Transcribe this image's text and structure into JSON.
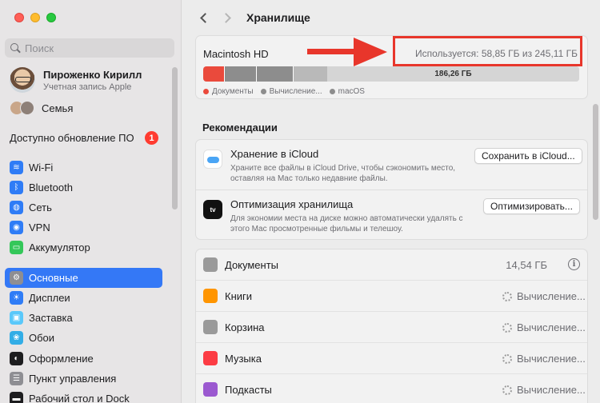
{
  "window": {
    "title": "Хранилище"
  },
  "search": {
    "placeholder": "Поиск"
  },
  "account": {
    "name": "Пироженко Кирилл",
    "subtitle": "Учетная запись Apple"
  },
  "family": {
    "label": "Семья"
  },
  "update": {
    "label": "Доступно обновление ПО",
    "badge": "1"
  },
  "sidebar": {
    "items": [
      {
        "label": "Wi‑Fi",
        "icon": "wifi-icon",
        "color": "#2f7cf6"
      },
      {
        "label": "Bluetooth",
        "icon": "bluetooth-icon",
        "color": "#2f7cf6"
      },
      {
        "label": "Сеть",
        "icon": "network-icon",
        "color": "#2f7cf6"
      },
      {
        "label": "VPN",
        "icon": "vpn-icon",
        "color": "#2f7cf6"
      },
      {
        "label": "Аккумулятор",
        "icon": "battery-icon",
        "color": "#34c759"
      },
      {
        "label": "Основные",
        "icon": "gear-icon",
        "color": "#8e8e93",
        "active": true
      },
      {
        "label": "Дисплеи",
        "icon": "display-icon",
        "color": "#2f7cf6"
      },
      {
        "label": "Заставка",
        "icon": "screensaver-icon",
        "color": "#5ac8fa"
      },
      {
        "label": "Обои",
        "icon": "wallpaper-icon",
        "color": "#32ade6"
      },
      {
        "label": "Оформление",
        "icon": "appearance-icon",
        "color": "#1d1d1f"
      },
      {
        "label": "Пункт управления",
        "icon": "control-center-icon",
        "color": "#8e8e93"
      },
      {
        "label": "Рабочий стол и Dock",
        "icon": "dock-icon",
        "color": "#1d1d1f"
      }
    ]
  },
  "storage": {
    "disk_name": "Macintosh HD",
    "usage_text": "Используется: 58,85 ГБ из 245,11 ГБ",
    "free_label": "186,26 ГБ",
    "legend": [
      {
        "label": "Документы",
        "color": "#ea4a3c"
      },
      {
        "label": "Вычисление...",
        "color": "#8d8d8d"
      },
      {
        "label": "macOS",
        "color": "#8d8d8d"
      }
    ]
  },
  "recommendations": {
    "title": "Рекомендации",
    "items": [
      {
        "title": "Хранение в iCloud",
        "description": "Храните все файлы в iCloud Drive, чтобы сэкономить место, оставляя на Mac только недавние файлы.",
        "button": "Сохранить в iCloud...",
        "icon": "icloud-icon"
      },
      {
        "title": "Оптимизация хранилища",
        "description": "Для экономии места на диске можно автоматически удалять с этого Mac просмотренные фильмы и телешоу.",
        "button": "Оптимизировать...",
        "icon": "apple-tv-icon",
        "icon_text": "tv"
      }
    ]
  },
  "categories": [
    {
      "label": "Документы",
      "value": "14,54 ГБ",
      "icon": "document-icon",
      "color": "#9a9a9a"
    },
    {
      "label": "Книги",
      "status": "Вычисление...",
      "icon": "books-icon",
      "color": "#ff9500"
    },
    {
      "label": "Корзина",
      "status": "Вычисление...",
      "icon": "trash-icon",
      "color": "#9a9a9a"
    },
    {
      "label": "Музыка",
      "status": "Вычисление...",
      "icon": "music-icon",
      "color": "#fc3c44"
    },
    {
      "label": "Подкасты",
      "status": "Вычисление...",
      "icon": "podcasts-icon",
      "color": "#9b59d0"
    }
  ]
}
